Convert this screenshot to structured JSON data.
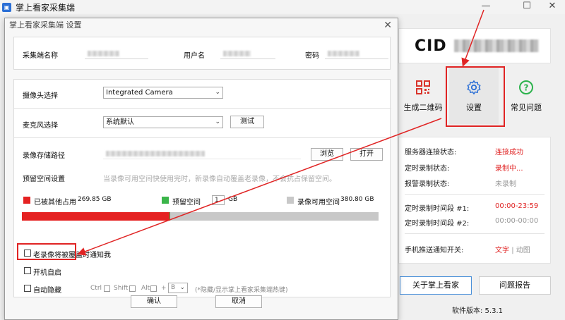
{
  "app": {
    "title": "掌上看家采集端",
    "cid_label": "CID",
    "tiles": [
      {
        "label": "生成二维码",
        "icon": "qr-code-icon"
      },
      {
        "label": "设置",
        "icon": "gear-icon"
      },
      {
        "label": "常见问题",
        "icon": "help-icon"
      }
    ],
    "status": {
      "server_label": "服务器连接状态:",
      "server_value": "连接成功",
      "timed_rec_label": "定时录制状态:",
      "timed_rec_value": "录制中...",
      "alarm_rec_label": "报警录制状态:",
      "alarm_rec_value": "未录制",
      "period1_label": "定时录制时间段 #1:",
      "period1_value": "00:00-23:59",
      "period2_label": "定时录制时间段 #2:",
      "period2_value": "00:00-00:00",
      "push_label": "手机推送通知开关:",
      "push_text": "文字",
      "push_sep": "|",
      "push_anim": "动图"
    },
    "about_button": "关于掌上看家",
    "report_button": "问题报告",
    "version": "软件版本: 5.3.1"
  },
  "dialog": {
    "title": "掌上看家采集端 设置",
    "collector_name_label": "采集端名称",
    "username_label": "用户名",
    "password_label": "密码",
    "camera_label": "摄像头选择",
    "camera_value": "Integrated Camera",
    "mic_label": "麦克风选择",
    "mic_value": "系统默认",
    "test_button": "测试",
    "storage_path_label": "录像存储路径",
    "browse_button": "浏览",
    "open_button": "打开",
    "reserve_label": "预留空间设置",
    "reserve_hint": "当录像可用空间快使用完时，新录像自动覆盖老录像，不会抗占保留空间。",
    "used_label": "已被其他占用",
    "used_value": "269.85 GB",
    "reserved_label": "预留空间",
    "reserved_value": "1",
    "reserved_unit": "GB",
    "available_label": "录像可用空间",
    "available_value": "380.80 GB",
    "notify_overwrite_label": "老录像将被覆盖时通知我",
    "autostart_label": "开机自启",
    "autohide_label": "自动隐藏",
    "ctrl_label": "Ctrl",
    "shift_label": "Shift",
    "alt_label": "Alt",
    "plus": "+",
    "key_value": "B",
    "hotkey_hint": "(*隐藏/显示掌上看家采集端热键)",
    "ok_button": "确认",
    "cancel_button": "取消"
  },
  "storage_chart": {
    "used_gb": 269.85,
    "reserved_gb": 1,
    "available_gb": 380.8
  },
  "colors": {
    "accent_red": "#e02424",
    "used_red": "#e52222",
    "reserve_green": "#3bb54a",
    "available_gray": "#c8c8c8"
  }
}
